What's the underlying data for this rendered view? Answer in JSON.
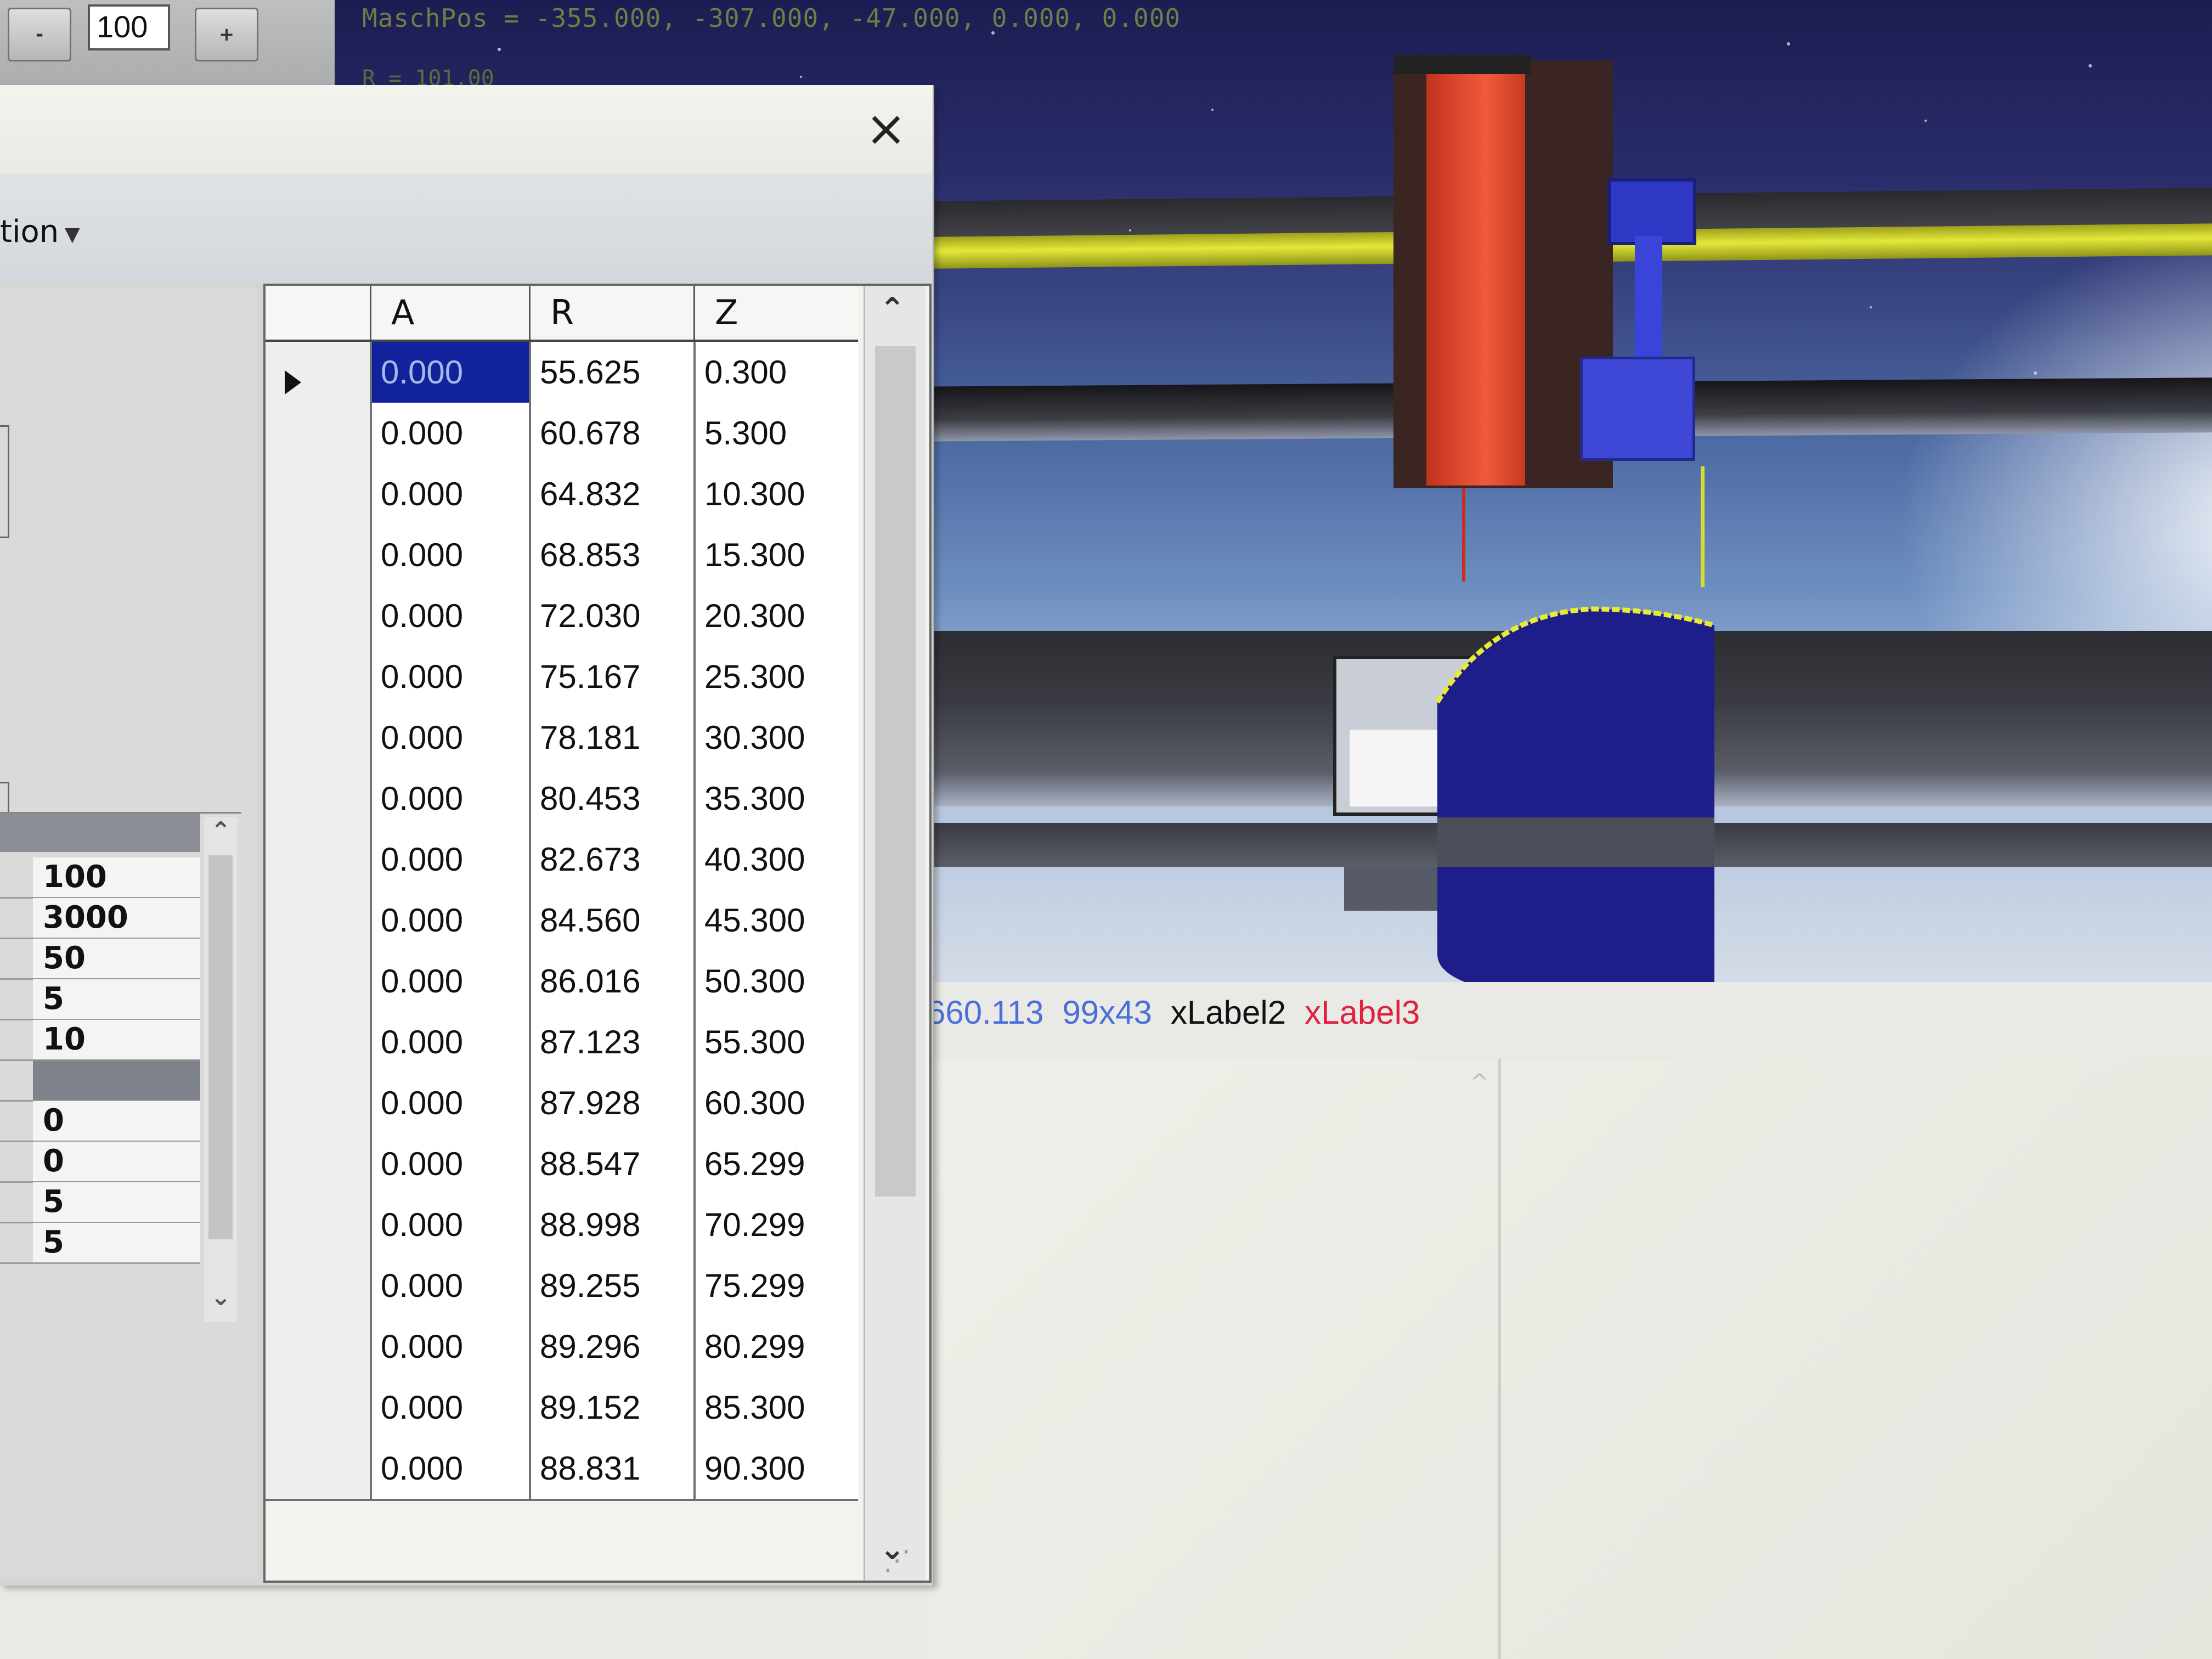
{
  "toolbar": {
    "minus_label": "-",
    "zoom_value": "100",
    "plus_label": "+"
  },
  "viewport": {
    "position_text": "MaschPos      = -355.000, -307.000, -47.000, 0.000, 0.000",
    "position_text_2": "R = 101.00",
    "status_values": [
      "660.113",
      "99x43",
      "xLabel2",
      "xLabel3"
    ],
    "status_colors": [
      "#4a6fd8",
      "#4a6fd8",
      "#111111",
      "#e0203c"
    ]
  },
  "dialog": {
    "close_label": "×",
    "menu_label": "tion",
    "grid": {
      "columns": [
        "A",
        "R",
        "Z"
      ],
      "rows": [
        [
          "0.000",
          "55.625",
          "0.300"
        ],
        [
          "0.000",
          "60.678",
          "5.300"
        ],
        [
          "0.000",
          "64.832",
          "10.300"
        ],
        [
          "0.000",
          "68.853",
          "15.300"
        ],
        [
          "0.000",
          "72.030",
          "20.300"
        ],
        [
          "0.000",
          "75.167",
          "25.300"
        ],
        [
          "0.000",
          "78.181",
          "30.300"
        ],
        [
          "0.000",
          "80.453",
          "35.300"
        ],
        [
          "0.000",
          "82.673",
          "40.300"
        ],
        [
          "0.000",
          "84.560",
          "45.300"
        ],
        [
          "0.000",
          "86.016",
          "50.300"
        ],
        [
          "0.000",
          "87.123",
          "55.300"
        ],
        [
          "0.000",
          "87.928",
          "60.300"
        ],
        [
          "0.000",
          "88.547",
          "65.299"
        ],
        [
          "0.000",
          "88.998",
          "70.299"
        ],
        [
          "0.000",
          "89.255",
          "75.299"
        ],
        [
          "0.000",
          "89.296",
          "80.299"
        ],
        [
          "0.000",
          "89.152",
          "85.300"
        ],
        [
          "0.000",
          "88.831",
          "90.300"
        ]
      ],
      "selected_row": 0
    }
  },
  "side_list": {
    "values": [
      "100",
      "3000",
      "50",
      "5",
      "10",
      "",
      "0",
      "0",
      "5",
      "5"
    ]
  },
  "colors": {
    "selection": "#12229c",
    "tool_red": "#e8452e",
    "rail_yellow": "#d8dc2a",
    "workpiece_blue": "#1e1e8a",
    "sensor_blue": "#3a40d0"
  }
}
